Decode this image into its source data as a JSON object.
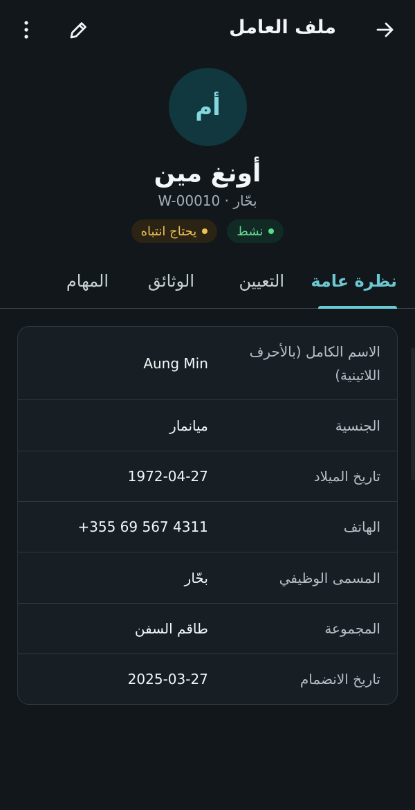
{
  "app_bar": {
    "title": "ملف العامل",
    "back_icon": "arrow-right-icon",
    "edit_icon": "pencil-icon",
    "more_icon": "more-vertical-icon"
  },
  "profile": {
    "avatar_initials": "أم",
    "name": "أونغ مين",
    "subtitle": "W-00010 · بحّار",
    "badges": [
      {
        "label": "نشط",
        "color": "#58d98d"
      },
      {
        "label": "يحتاج انتباه",
        "color": "#f1bf52"
      }
    ]
  },
  "tabs": [
    {
      "label": "نظرة عامة",
      "active": true
    },
    {
      "label": "التعيين",
      "active": false
    },
    {
      "label": "الوثائق",
      "active": false
    },
    {
      "label": "المهام",
      "active": false
    }
  ],
  "details": [
    {
      "label": "الاسم الكامل (بالأحرف اللاتينية)",
      "value": "Aung Min"
    },
    {
      "label": "الجنسية",
      "value": "ميانمار"
    },
    {
      "label": "تاريخ الميلاد",
      "value": "1972-04-27"
    },
    {
      "label": "الهاتف",
      "value": "+355 69 567 4311"
    },
    {
      "label": "المسمى الوظيفي",
      "value": "بحّار"
    },
    {
      "label": "المجموعة",
      "value": "طاقم السفن"
    },
    {
      "label": "تاريخ الانضمام",
      "value": "2025-03-27"
    }
  ],
  "colors": {
    "background": "#11171b",
    "accent": "#68c9d2",
    "active_status": "#58d98d",
    "attention_status": "#f1bf52"
  }
}
